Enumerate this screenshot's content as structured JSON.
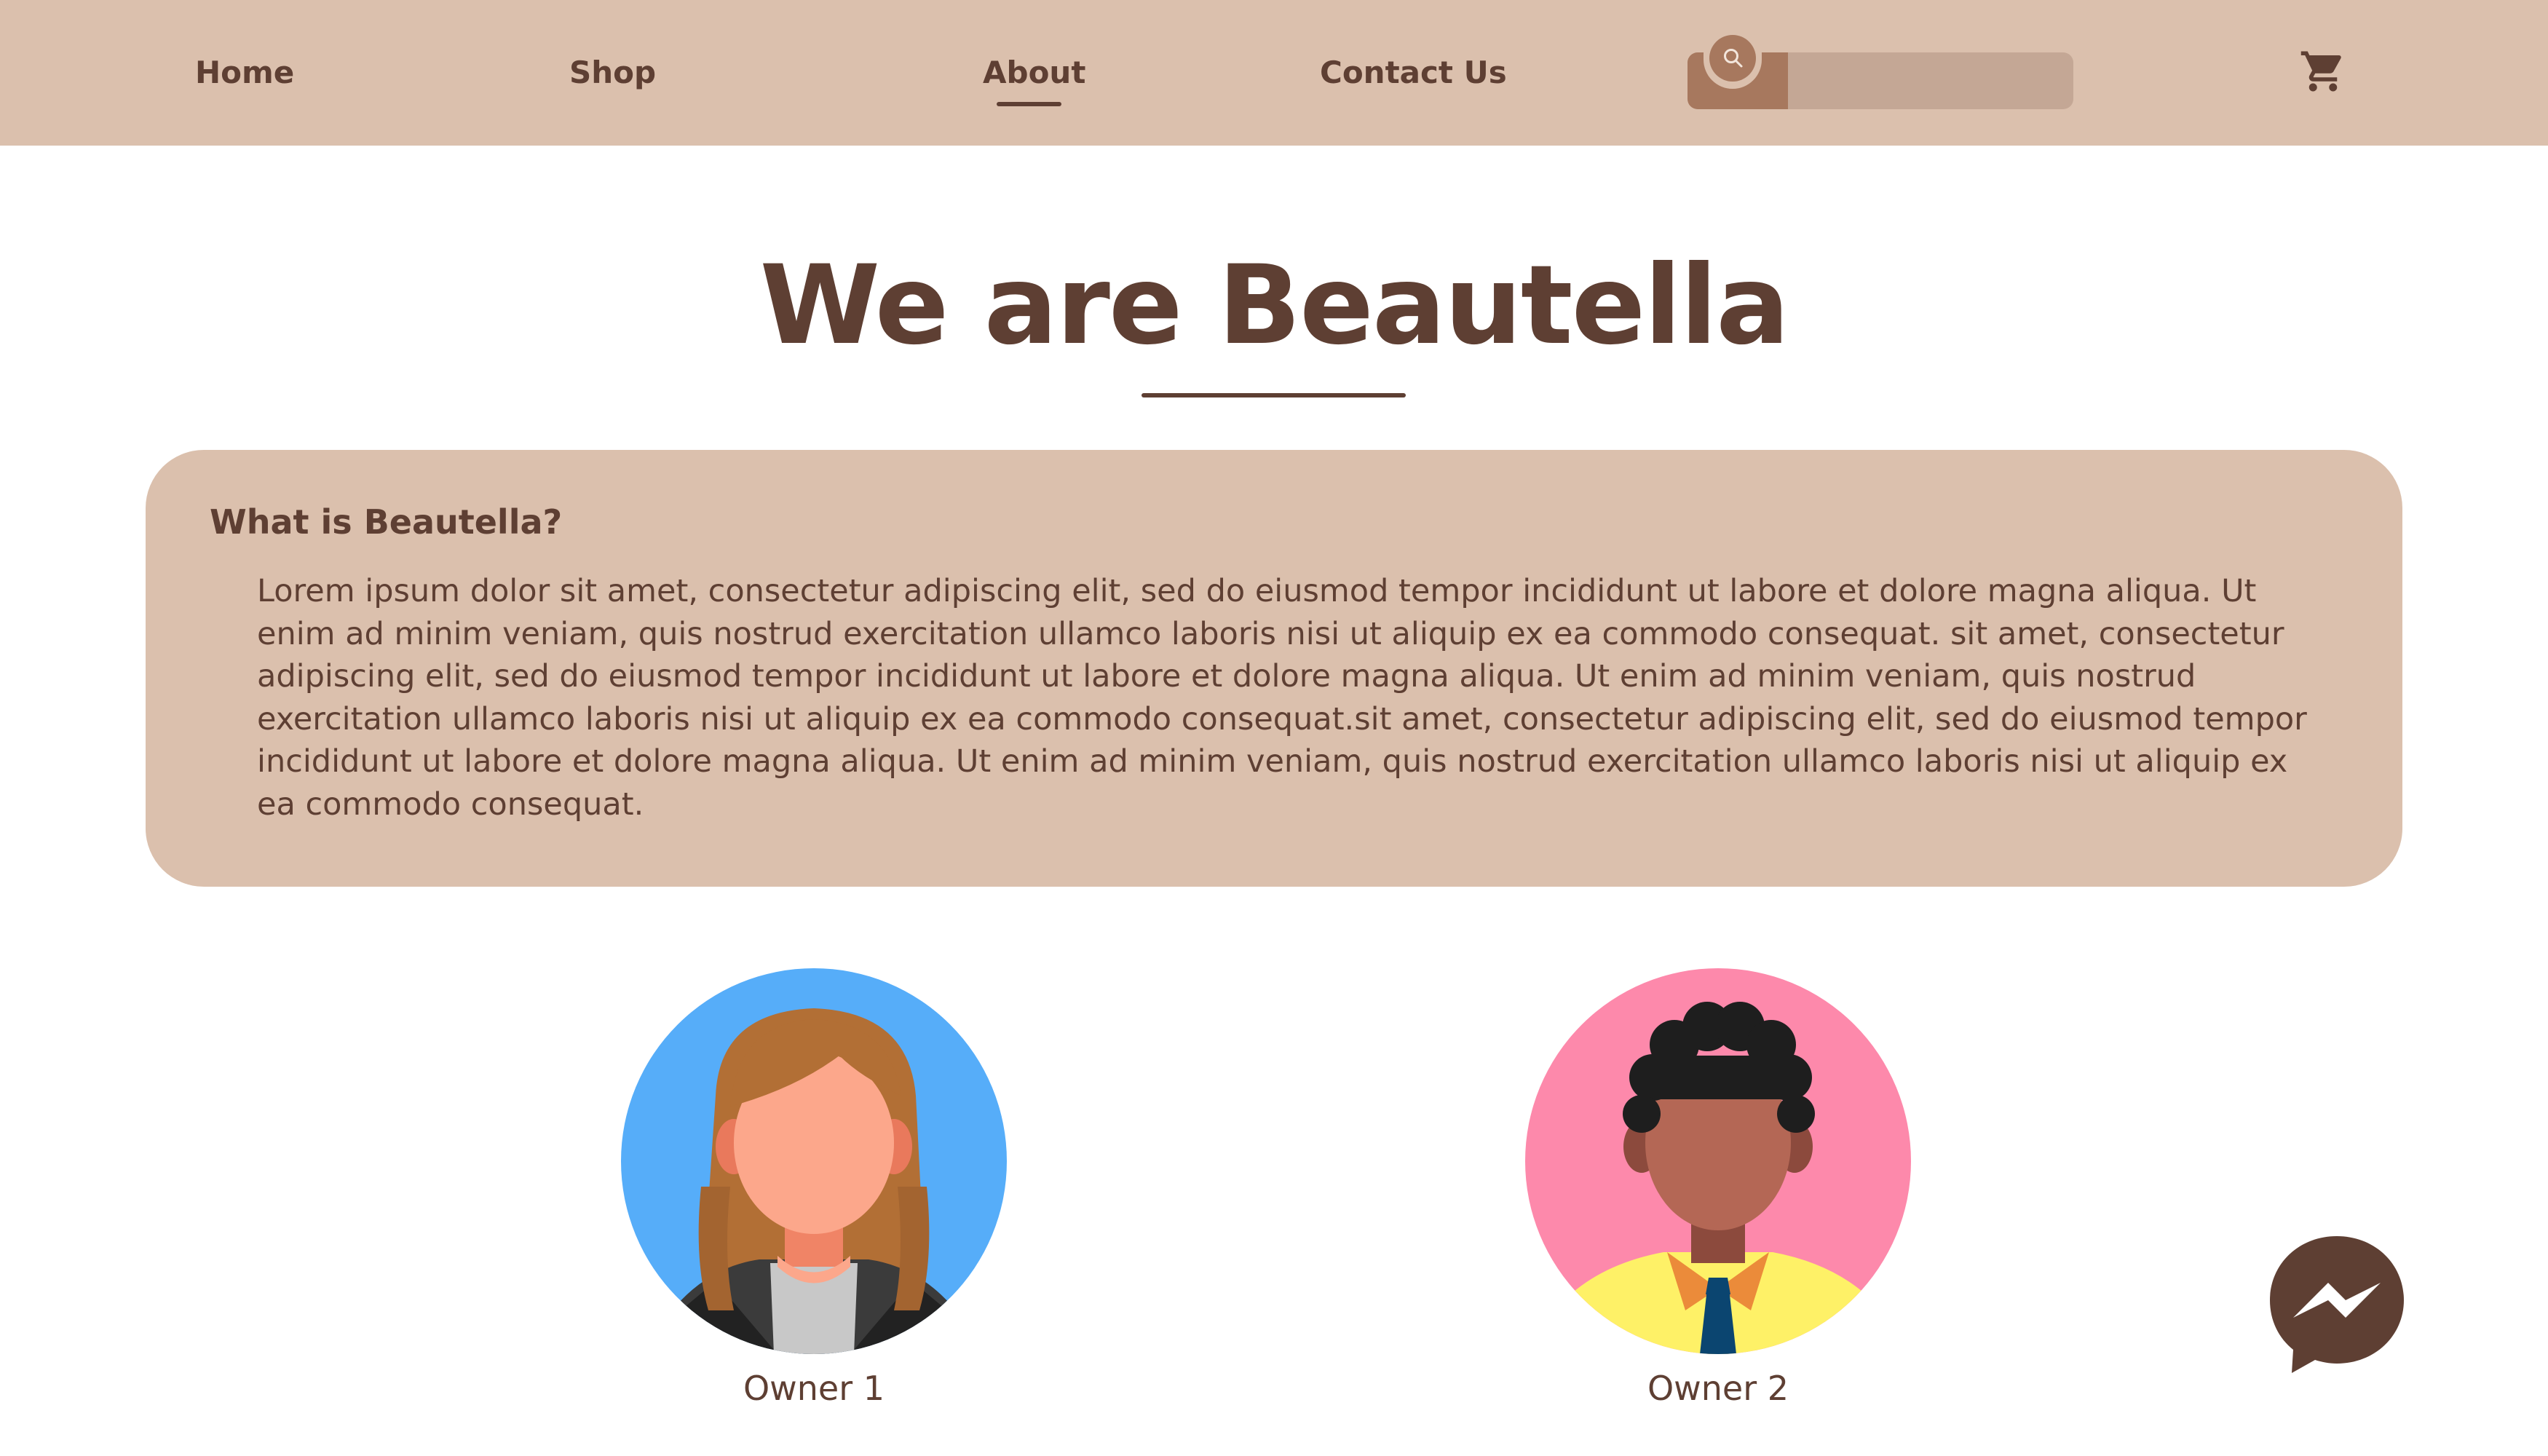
{
  "nav": {
    "links": [
      {
        "label": "Home"
      },
      {
        "label": "Shop"
      },
      {
        "label": "About",
        "active": true
      },
      {
        "label": "Contact Us"
      }
    ],
    "search": {
      "placeholder": "",
      "value": ""
    },
    "cart_icon": "shopping-cart-icon",
    "search_icon": "magnifier-icon"
  },
  "hero": {
    "title": "We are Beautella"
  },
  "info": {
    "heading": "What is Beautella?",
    "body": "Lorem ipsum dolor sit amet, consectetur adipiscing elit, sed do eiusmod tempor incididunt ut labore et dolore magna aliqua. Ut enim ad minim veniam, quis nostrud exercitation ullamco laboris nisi ut aliquip ex ea commodo consequat. sit amet, consectetur adipiscing elit, sed do eiusmod tempor incididunt ut labore et dolore magna aliqua. Ut enim ad minim veniam, quis nostrud exercitation ullamco laboris nisi ut aliquip ex ea commodo consequat.sit amet, consectetur adipiscing elit, sed do eiusmod tempor incididunt ut labore et dolore magna aliqua. Ut enim ad minim veniam, quis nostrud exercitation ullamco laboris nisi ut aliquip ex ea commodo consequat."
  },
  "owners": [
    {
      "name": "Owner 1",
      "avatar": "woman-avatar",
      "bg_color": "#56adf9"
    },
    {
      "name": "Owner 2",
      "avatar": "man-avatar",
      "bg_color": "#fd89ab"
    }
  ],
  "chat": {
    "icon": "messenger-icon"
  },
  "colors": {
    "nav_bg": "#dbc0ad",
    "card_bg": "#dbc0ad",
    "text_brown": "#5e3f33",
    "search_accent": "#a7785e",
    "search_field": "#c4a795"
  }
}
